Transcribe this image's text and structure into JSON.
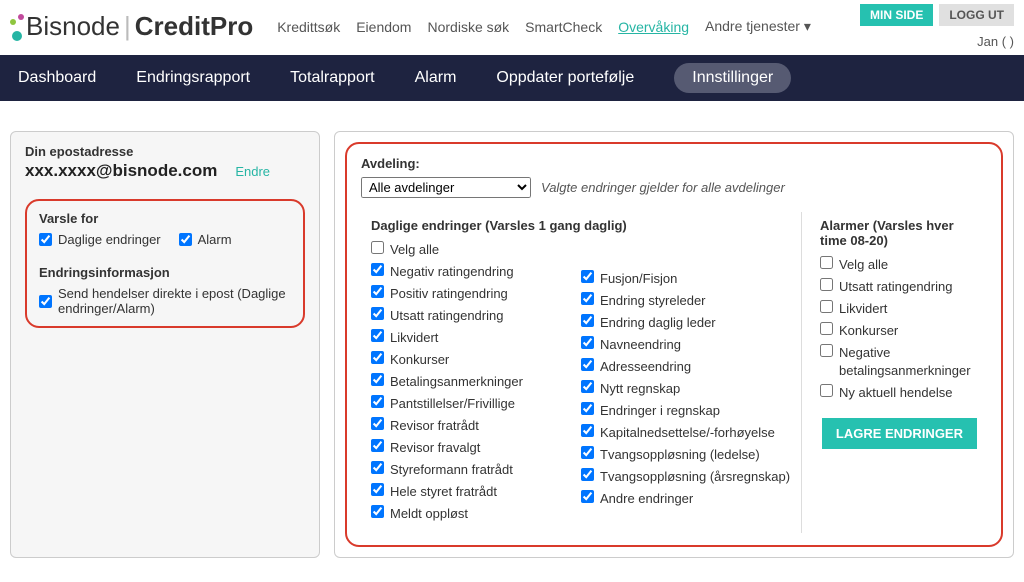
{
  "top": {
    "logo1": "Bisnode",
    "logo2": "CreditPro",
    "min_side": "MIN SIDE",
    "logg_ut": "LOGG UT",
    "user": "Jan          (            )"
  },
  "mainnav": {
    "kredittsok": "Kredittsøk",
    "eiendom": "Eiendom",
    "nordiske": "Nordiske søk",
    "smartcheck": "SmartCheck",
    "overvaking": "Overvåking",
    "andre": "Andre tjenester ▾"
  },
  "subnav": {
    "dashboard": "Dashboard",
    "endringsrapport": "Endringsrapport",
    "totalrapport": "Totalrapport",
    "alarm": "Alarm",
    "oppdater": "Oppdater portefølje",
    "innstillinger": "Innstillinger"
  },
  "left": {
    "email_label": "Din epostadresse",
    "email": "xxx.xxxx@bisnode.com",
    "endre": "Endre",
    "varsle_for": "Varsle for",
    "daglige": "Daglige endringer",
    "alarm": "Alarm",
    "endringsinfo": "Endringsinformasjon",
    "send_hendelser": "Send hendelser direkte i epost (Daglige endringer/Alarm)"
  },
  "right": {
    "avdeling": "Avdeling:",
    "alle_avdelinger": "Alle avdelinger",
    "valgte": "Valgte endringer gjelder for alle avdelinger",
    "daglige_h": "Daglige endringer (Varsles 1 gang daglig)",
    "velg_alle": "Velg alle",
    "c1": [
      "Negativ ratingendring",
      "Positiv ratingendring",
      "Utsatt ratingendring",
      "Likvidert",
      "Konkurser",
      "Betalingsanmerkninger",
      "Pantstillelser/Frivillige",
      "Revisor fratrådt",
      "Revisor fravalgt",
      "Styreformann fratrådt",
      "Hele styret fratrådt",
      "Meldt oppløst"
    ],
    "c2": [
      "Fusjon/Fisjon",
      "Endring styreleder",
      "Endring daglig leder",
      "Navneendring",
      "Adresseendring",
      "Nytt regnskap",
      "Endringer i regnskap",
      "Kapitalnedsettelse/-forhøyelse",
      "Tvangsoppløsning (ledelse)",
      "Tvangsoppløsning (årsregnskap)",
      "Andre endringer"
    ],
    "alarmer_h": "Alarmer (Varsles hver time 08-20)",
    "a_velg_alle": "Velg alle",
    "a": [
      "Utsatt ratingendring",
      "Likvidert",
      "Konkurser",
      "Negative betalingsanmerkninger",
      "Ny aktuell hendelse"
    ],
    "lagre": "LAGRE ENDRINGER"
  }
}
